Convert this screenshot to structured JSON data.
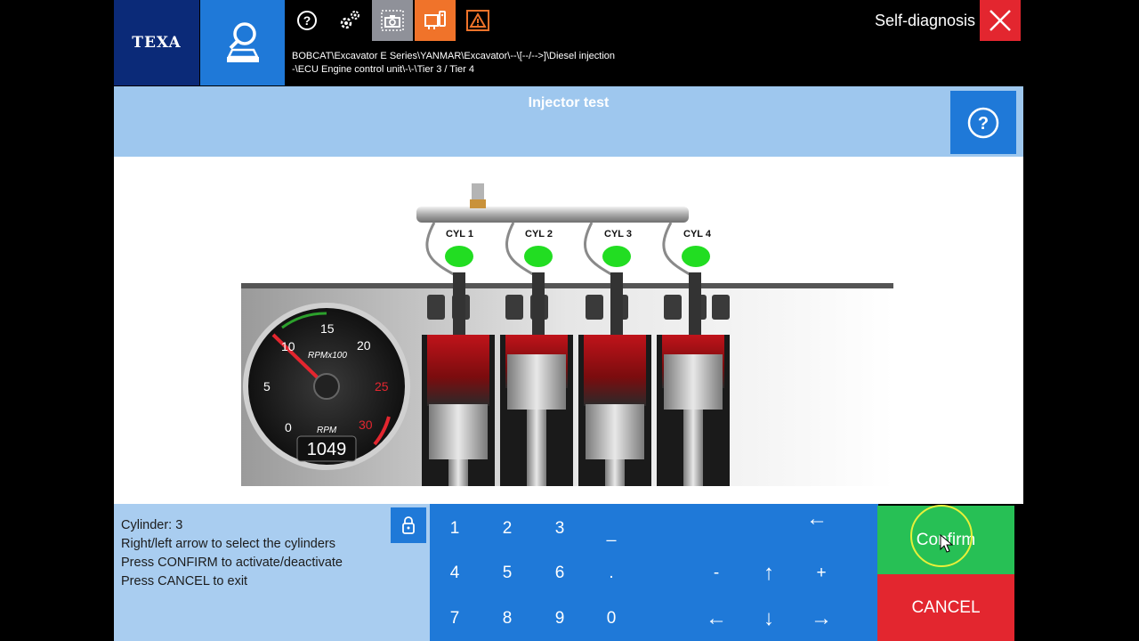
{
  "header": {
    "logo": "TEXA",
    "path": "BOBCAT\\Excavator E Series\\YANMAR\\Excavator\\--\\[--/-->]\\Diesel injection\n-\\ECU Engine control unit\\-\\-\\Tier 3 / Tier 4",
    "mode_title": "Self-diagnosis",
    "toolbar_icons": [
      "help-icon",
      "settings-icon",
      "screenshot-icon",
      "device-icon",
      "warning-icon"
    ]
  },
  "page": {
    "title": "Injector test"
  },
  "engine": {
    "cylinders": [
      "CYL 1",
      "CYL 2",
      "CYL 3",
      "CYL 4"
    ],
    "injector_status_color": "#22dd22"
  },
  "gauge": {
    "ticks": [
      "0",
      "5",
      "10",
      "15",
      "20",
      "25",
      "30"
    ],
    "unit_top": "RPMx100",
    "unit_bottom": "RPM",
    "rpm_value": "1049"
  },
  "info": {
    "lines": [
      "Cylinder: 3",
      "Right/left arrow to select the cylinders",
      "Press CONFIRM to activate/deactivate",
      "Press CANCEL to exit"
    ]
  },
  "keypad": {
    "digits": [
      "1",
      "2",
      "3",
      "_",
      "4",
      "5",
      "6",
      ".",
      "7",
      "8",
      "9",
      "0"
    ],
    "backspace": "←",
    "minus": "-",
    "plus": "+",
    "up": "↑",
    "down": "↓",
    "left": "←",
    "right": "→"
  },
  "actions": {
    "confirm": "Confirm",
    "cancel": "CANCEL"
  },
  "colors": {
    "accent": "#1f79d8",
    "title_band": "#9ec7ee",
    "confirm": "#27c055",
    "cancel": "#e3262f",
    "logo_bg": "#0b2a78"
  }
}
